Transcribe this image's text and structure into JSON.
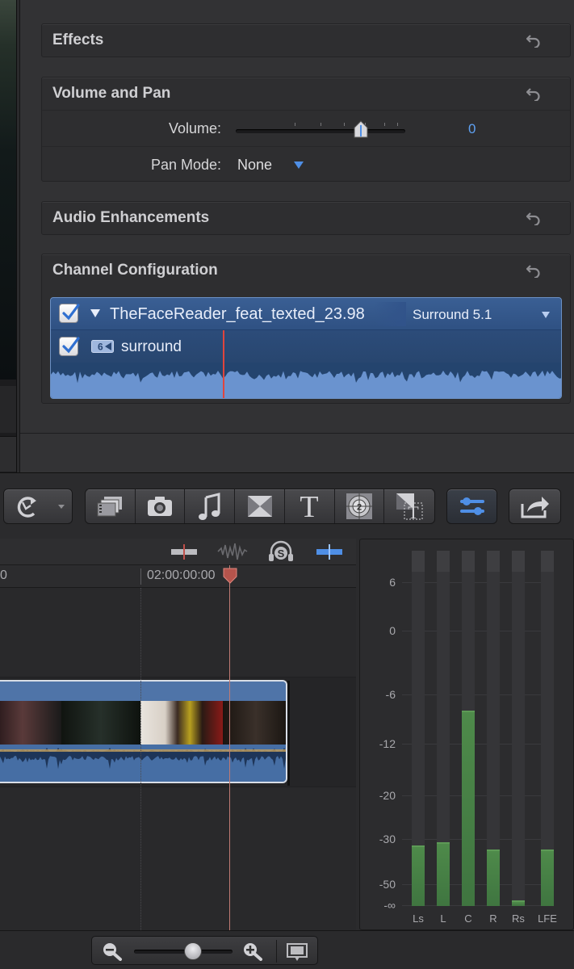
{
  "inspector": {
    "sections": {
      "effects": {
        "title": "Effects"
      },
      "volume_pan": {
        "title": "Volume and Pan",
        "volume_label": "Volume:",
        "volume_value": "0",
        "volume_level": 0.74,
        "pan_mode_label": "Pan Mode:",
        "pan_mode_value": "None"
      },
      "audio_enhancements": {
        "title": "Audio Enhancements"
      },
      "channel_configuration": {
        "title": "Channel Configuration",
        "clip_name": "TheFaceReader_feat_texted_23.98",
        "format": "Surround 5.1",
        "channel_badge": "6",
        "channel_name": "surround"
      }
    }
  },
  "toolbar": {
    "buttons": [
      "retime",
      "media-browser",
      "photos",
      "music",
      "transitions",
      "titles",
      "generators",
      "themes",
      "inspector-toggle",
      "share"
    ]
  },
  "timeline": {
    "ruler": {
      "left_label": "0",
      "timecode": "02:00:00:00"
    }
  },
  "meters": {
    "db_labels": [
      "6",
      "0",
      "-6",
      "-12",
      "-20",
      "-30",
      "-50",
      "-∞"
    ],
    "channels": [
      {
        "name": "Ls",
        "level": 0.17
      },
      {
        "name": "L",
        "level": 0.18
      },
      {
        "name": "C",
        "level": 0.55
      },
      {
        "name": "R",
        "level": 0.16
      },
      {
        "name": "Rs",
        "level": 0.015
      },
      {
        "name": "LFE",
        "level": 0.16
      }
    ],
    "fill_color": "#4e8a4a"
  },
  "zoom": {
    "level": 0.6
  },
  "colors": {
    "accent": "#5ea0f2",
    "playhead": "#e0453d",
    "selection": "#2f5183"
  }
}
